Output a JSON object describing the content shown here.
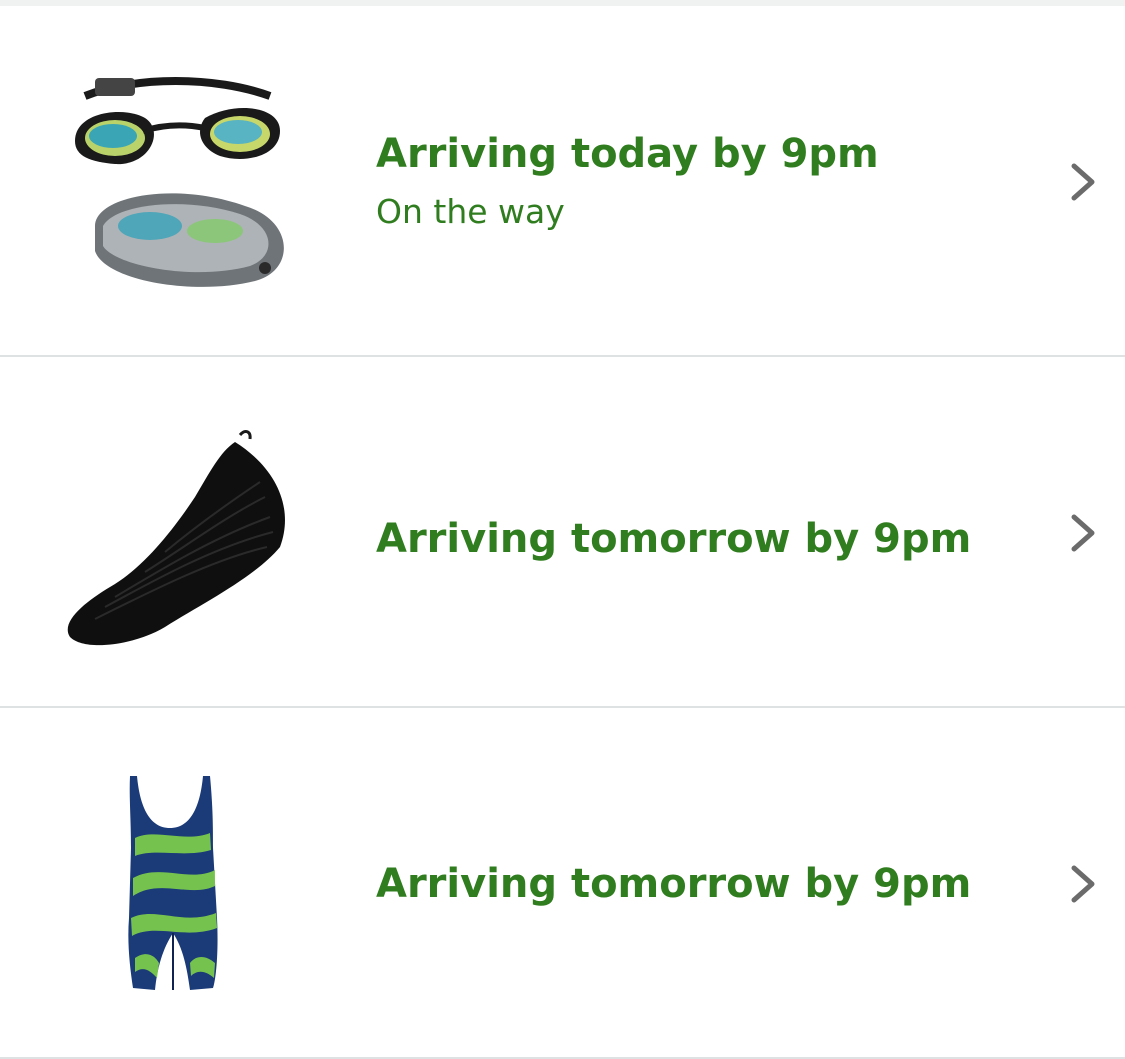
{
  "deliveries": [
    {
      "title": "Arriving today by 9pm",
      "status": "On the way",
      "image_icon": "swim-goggles-image"
    },
    {
      "title": "Arriving tomorrow by 9pm",
      "status": "",
      "image_icon": "water-shoe-image"
    },
    {
      "title": "Arriving tomorrow by 9pm",
      "status": "",
      "image_icon": "swimsuit-image"
    }
  ],
  "colors": {
    "accent_green": "#2f7d1e",
    "chevron_gray": "#6b6b6b",
    "divider": "#dfe2e2",
    "background": "#f0f2f2"
  },
  "icons": {
    "row_chevron": "chevron-right-icon"
  }
}
